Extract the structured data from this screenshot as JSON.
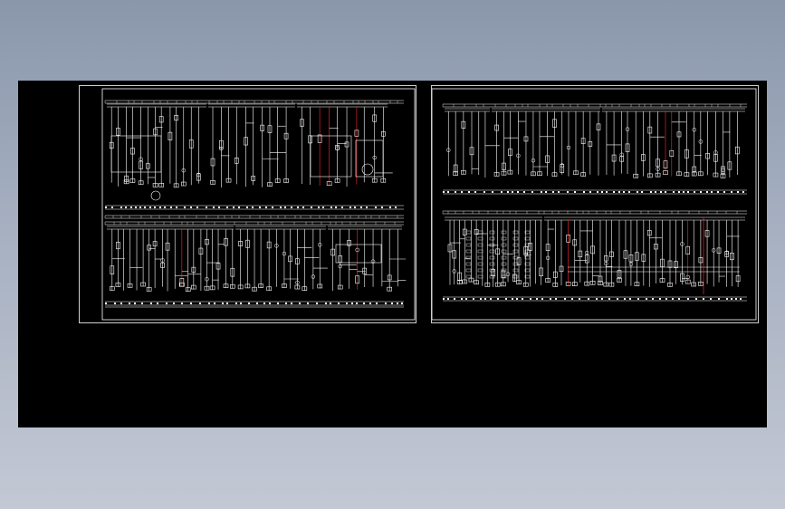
{
  "viewer": {
    "background_color": "#000000",
    "line_color": "#ffffff",
    "accent_color": "#ff2a2a"
  },
  "sheets": [
    {
      "id": "sheet-1",
      "panels": [
        "upper-schematic",
        "lower-schematic"
      ]
    },
    {
      "id": "sheet-2",
      "panels": [
        "upper-schematic",
        "lower-schematic"
      ]
    }
  ]
}
